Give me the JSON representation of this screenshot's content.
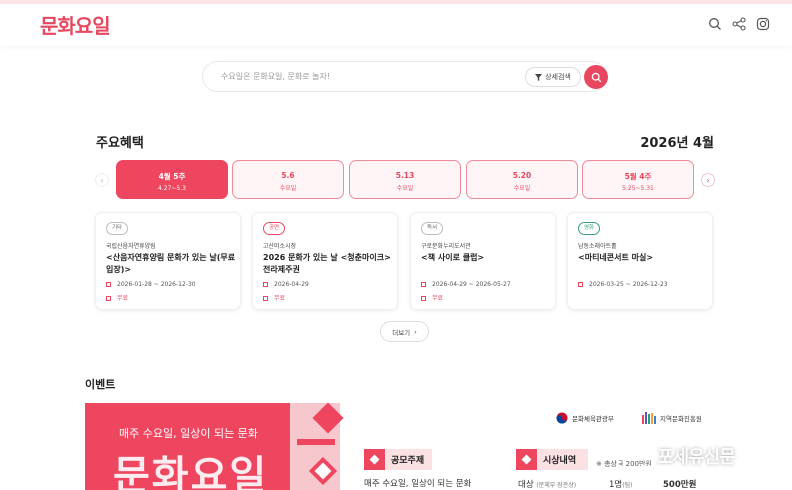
{
  "header": {
    "logo": "문화요일",
    "icons": [
      "search-icon",
      "share-icon",
      "instagram-icon"
    ]
  },
  "search": {
    "placeholder": "수요일은 문화요일, 문화로 놀자!",
    "advanced_label": "상세검색"
  },
  "benefits": {
    "title": "주요혜택",
    "month": "2026년 4월",
    "weeks": [
      {
        "label": "4월 5주",
        "sub": "4.27~5.3",
        "active": true
      },
      {
        "label": "5.6",
        "sub": "수요일",
        "active": false
      },
      {
        "label": "5.13",
        "sub": "수요일",
        "active": false
      },
      {
        "label": "5.20",
        "sub": "수요일",
        "active": false
      },
      {
        "label": "5월 4주",
        "sub": "5.25~5.31",
        "active": false
      }
    ],
    "cards": [
      {
        "tag": "기타",
        "venue": "국립산음자연휴양림",
        "title": "<산음자연휴양림 문화가 있는 날(무료입장)>",
        "date": "2026-01-28 ~ 2026-12-30",
        "price": "무료"
      },
      {
        "tag": "공연",
        "venue": "고산미소시장",
        "title": "2026 문화가 있는 날 <청춘마이크> 전라제주권",
        "date": "2026-04-29",
        "price": "무료"
      },
      {
        "tag": "독서",
        "venue": "구로문화누리도서관",
        "title": "<책 사이로 클럽>",
        "date": "2026-04-29 ~ 2026-05-27",
        "price": "무료"
      },
      {
        "tag": "영화",
        "venue": "남동소래아트홀",
        "title": "<마티네콘서트 마실>",
        "date": "2026-03-25 ~ 2026-12-23",
        "price": ""
      }
    ],
    "more_label": "더보기"
  },
  "events": {
    "title": "이벤트",
    "banner": {
      "subtitle": "매주 수요일, 일상이 되는 문화",
      "logo": "문화요일",
      "org1": "문화체육관광부",
      "org2": "지역문화진흥원",
      "section1": "공모주제",
      "section1_text": "매주 수요일, 일상이 되는 문화",
      "section2": "시상내역",
      "note": "※ 총상금 200만원",
      "award_label": "대상",
      "award_sub": "(문체부 장관상)",
      "award_count": "1명",
      "award_count_unit": "(팀)",
      "award_amount": "500만원"
    }
  },
  "watermark": "포세유신문",
  "colors": {
    "accent": "#ef4660",
    "accent_light": "#fff5f6"
  }
}
